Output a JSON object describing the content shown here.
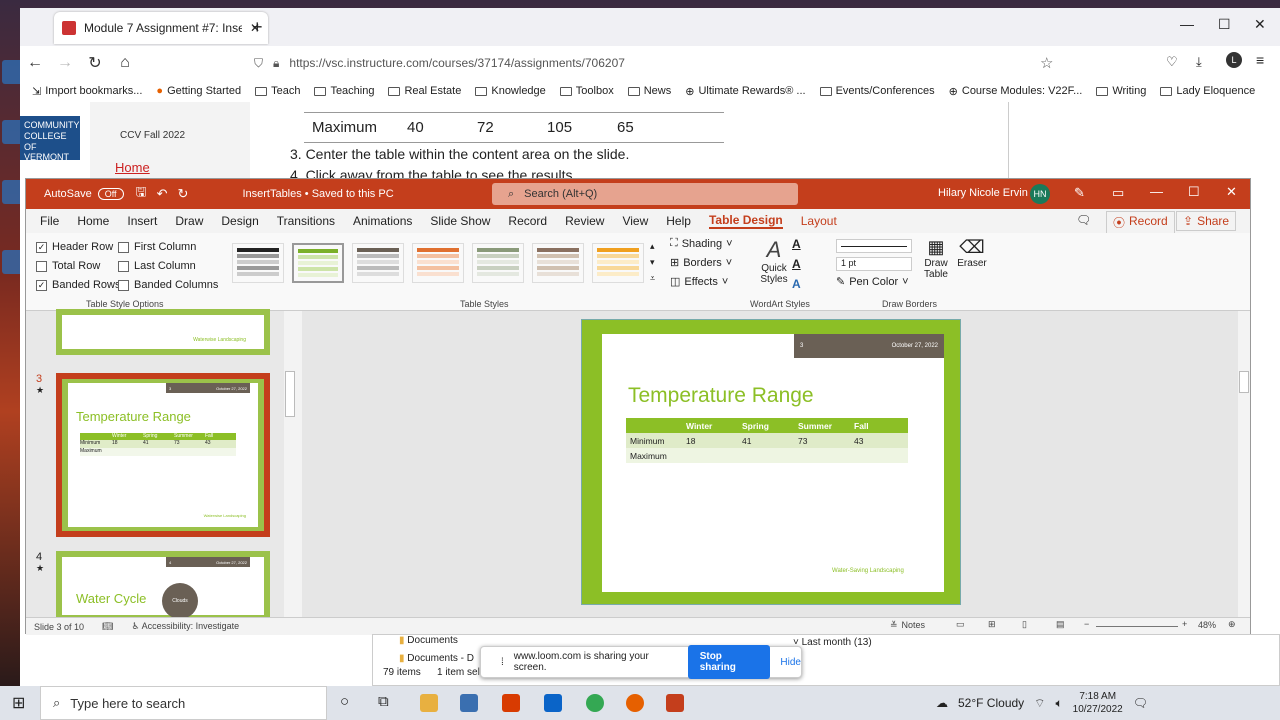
{
  "browser": {
    "tab_title": "Module 7 Assignment #7: Insert",
    "url": "https://vsc.instructure.com/courses/37174/assignments/706207",
    "bookmarks": [
      "Import bookmarks...",
      "Getting Started",
      "Teach",
      "Teaching",
      "Real Estate",
      "Knowledge",
      "Toolbox",
      "News",
      "Ultimate Rewards® ...",
      "Events/Conferences",
      "Course Modules: V22F...",
      "Writing",
      "Lady Eloquence"
    ]
  },
  "web": {
    "logo": "COMMUNITY COLLEGE OF VERMONT",
    "course": "CCV Fall 2022",
    "home": "Home",
    "table_row": [
      "Maximum",
      "40",
      "72",
      "105",
      "65"
    ],
    "step3": "3. Center the table within the content area on the slide.",
    "step4": "4. Click away from the table to see the results."
  },
  "ppt": {
    "autosave": "AutoSave",
    "autosave_state": "Off",
    "doc": "InsertTables • Saved to this PC",
    "search": "Search (Alt+Q)",
    "user": "Hilary Nicole Ervin",
    "initials": "HN",
    "menu": [
      "File",
      "Home",
      "Insert",
      "Draw",
      "Design",
      "Transitions",
      "Animations",
      "Slide Show",
      "Record",
      "Review",
      "View",
      "Help",
      "Table Design",
      "Layout"
    ],
    "record_btn": "Record",
    "share_btn": "Share",
    "options": {
      "header_row": "Header Row",
      "first_column": "First Column",
      "total_row": "Total Row",
      "last_column": "Last Column",
      "banded_rows": "Banded Rows",
      "banded_columns": "Banded Columns"
    },
    "groups": {
      "tso": "Table Style Options",
      "ts": "Table Styles",
      "wa": "WordArt Styles",
      "db": "Draw Borders"
    },
    "shading": "Shading",
    "borders": "Borders",
    "effects": "Effects",
    "quick_styles": "Quick Styles",
    "pt": "1 pt",
    "pen_color": "Pen Color",
    "draw_table": "Draw Table",
    "eraser": "Eraser",
    "thumb3_num": "3",
    "thumb4_num": "4",
    "thumb3_title": "Temperature Range",
    "thumb4_title": "Water Cycle",
    "thumb4_circle": "Clouds",
    "thumb_footer": "Waterwise Landscaping",
    "thumb_date": "October 27, 2022",
    "thumb_hdr_num": "3",
    "thumb4_hdr_num": "4",
    "thumb_table": {
      "header": [
        "Winter",
        "Spring",
        "Summer",
        "Fall"
      ],
      "rows": [
        [
          "Minimum",
          "18",
          "41",
          "73",
          "43"
        ],
        [
          "Maximum",
          "",
          "",
          "",
          ""
        ]
      ]
    },
    "slide": {
      "title": "Temperature Range",
      "date": "October 27, 2022",
      "num": "3",
      "footer": "Water-Saving Landscaping",
      "header": [
        "",
        "Winter",
        "Spring",
        "Summer",
        "Fall"
      ],
      "rows": [
        [
          "Minimum",
          "18",
          "41",
          "73",
          "43"
        ],
        [
          "Maximum",
          "",
          "",
          "",
          ""
        ]
      ]
    },
    "status": {
      "slide": "Slide 3 of 10",
      "access": "Accessibility: Investigate",
      "notes": "Notes",
      "zoom": "48%"
    }
  },
  "explorer": {
    "items": "79 items",
    "selected": "1 item sel",
    "docs1": "Documents",
    "docs2": "Documents - D",
    "lastmonth": "Last month (13)"
  },
  "loom": {
    "msg": "www.loom.com is sharing your screen.",
    "stop": "Stop sharing",
    "hide": "Hide"
  },
  "taskbar": {
    "search": "Type here to search",
    "weather": "52°F  Cloudy",
    "time": "7:18 AM",
    "date": "10/27/2022"
  }
}
